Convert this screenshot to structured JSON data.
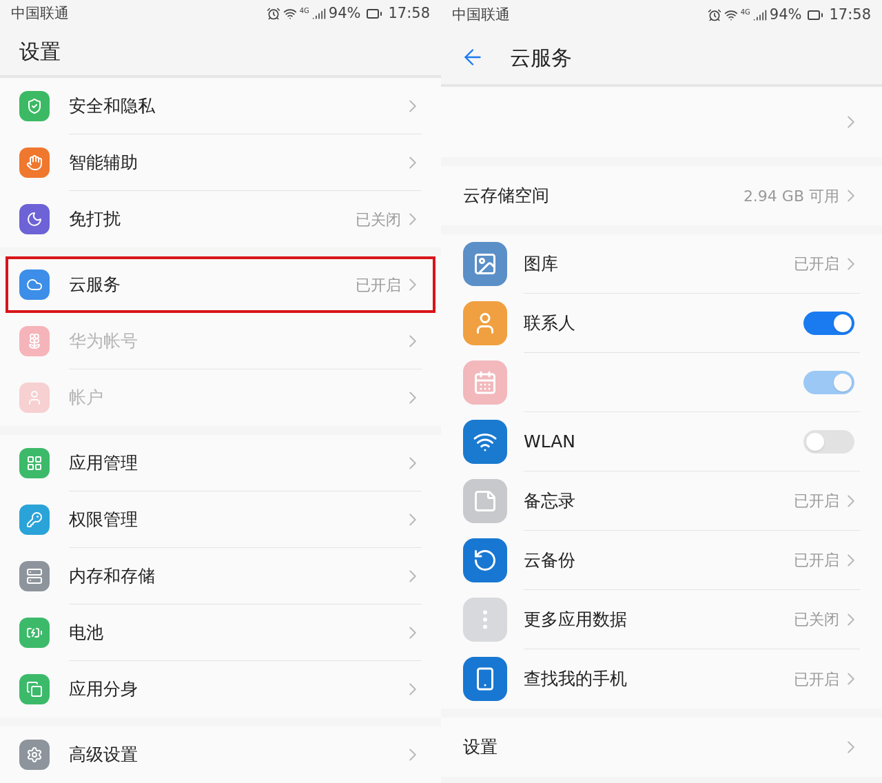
{
  "panels": [
    {
      "status_bar": {
        "carrier": "中国联通",
        "network": "4G",
        "battery": "94%",
        "time": "17:58"
      },
      "header": {
        "title": "设置"
      },
      "groups": [
        {
          "rows": [
            {
              "kind": "link",
              "label": "安全和隐私",
              "disabled": false,
              "highlighted": false
            },
            {
              "kind": "link",
              "label": "智能辅助",
              "disabled": false,
              "highlighted": false
            },
            {
              "kind": "link",
              "label": "免打扰",
              "value": "已关闭",
              "disabled": false,
              "highlighted": false
            }
          ]
        },
        {
          "rows": [
            {
              "kind": "link",
              "label": "云服务",
              "value": "已开启",
              "disabled": false,
              "highlighted": true
            },
            {
              "kind": "link",
              "label": "华为帐号",
              "disabled": true,
              "highlighted": false
            },
            {
              "kind": "link",
              "label": "帐户",
              "disabled": true,
              "highlighted": false
            }
          ]
        },
        {
          "rows": [
            {
              "kind": "link",
              "label": "应用管理",
              "disabled": false,
              "highlighted": false
            },
            {
              "kind": "link",
              "label": "权限管理",
              "disabled": false,
              "highlighted": false
            },
            {
              "kind": "link",
              "label": "内存和存储",
              "disabled": false,
              "highlighted": false
            },
            {
              "kind": "link",
              "label": "电池",
              "disabled": false,
              "highlighted": false
            },
            {
              "kind": "link",
              "label": "应用分身",
              "disabled": false,
              "highlighted": false
            }
          ]
        },
        {
          "rows": [
            {
              "kind": "link",
              "label": "高级设置",
              "disabled": false,
              "highlighted": false
            }
          ]
        }
      ]
    },
    {
      "status_bar": {
        "carrier": "中国联通",
        "network": "4G",
        "battery": "94%",
        "time": "17:58"
      },
      "header": {
        "title": "云服务",
        "back": true
      },
      "groups": [
        {
          "rows": [
            {
              "kind": "blank"
            }
          ]
        },
        {
          "rows": [
            {
              "kind": "plain",
              "label": "云存储空间",
              "value": "2.94 GB 可用"
            }
          ]
        },
        {
          "rows": [
            {
              "kind": "link",
              "label": "图库",
              "value": "已开启"
            },
            {
              "kind": "toggle",
              "label": "联系人",
              "on": true,
              "disabled": false
            },
            {
              "kind": "toggle",
              "on": true,
              "disabled": true
            },
            {
              "kind": "toggle",
              "label": "WLAN",
              "on": false,
              "disabled": false
            },
            {
              "kind": "link",
              "label": "备忘录",
              "value": "已开启"
            },
            {
              "kind": "link",
              "label": "云备份",
              "value": "已开启"
            },
            {
              "kind": "link",
              "label": "更多应用数据",
              "value": "已关闭"
            },
            {
              "kind": "link",
              "label": "查找我的手机",
              "value": "已开启"
            }
          ]
        },
        {
          "rows": [
            {
              "kind": "plain",
              "label": "设置"
            }
          ]
        }
      ]
    }
  ]
}
